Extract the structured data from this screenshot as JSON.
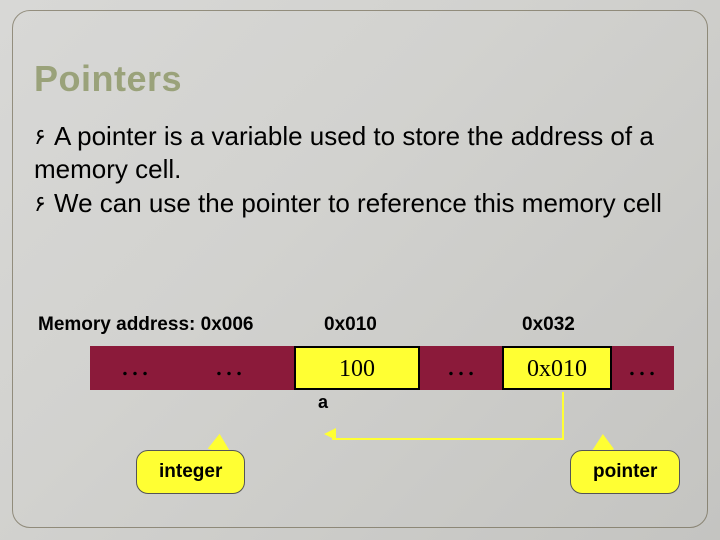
{
  "title": "Pointers",
  "bullets": {
    "b1": "A pointer is a variable used to store the address of a memory cell.",
    "b2": "We can use the pointer to reference this memory cell"
  },
  "memory": {
    "label_prefix": "Memory address:",
    "addr0": "0x006",
    "addr1": "0x010",
    "addr2": "0x032",
    "cells": {
      "c0": "…",
      "c1": "…",
      "c2": "100",
      "c3": "…",
      "c4": "0x010",
      "c5": "…"
    },
    "var_label": "a"
  },
  "callouts": {
    "integer": "integer",
    "pointer": "pointer"
  }
}
